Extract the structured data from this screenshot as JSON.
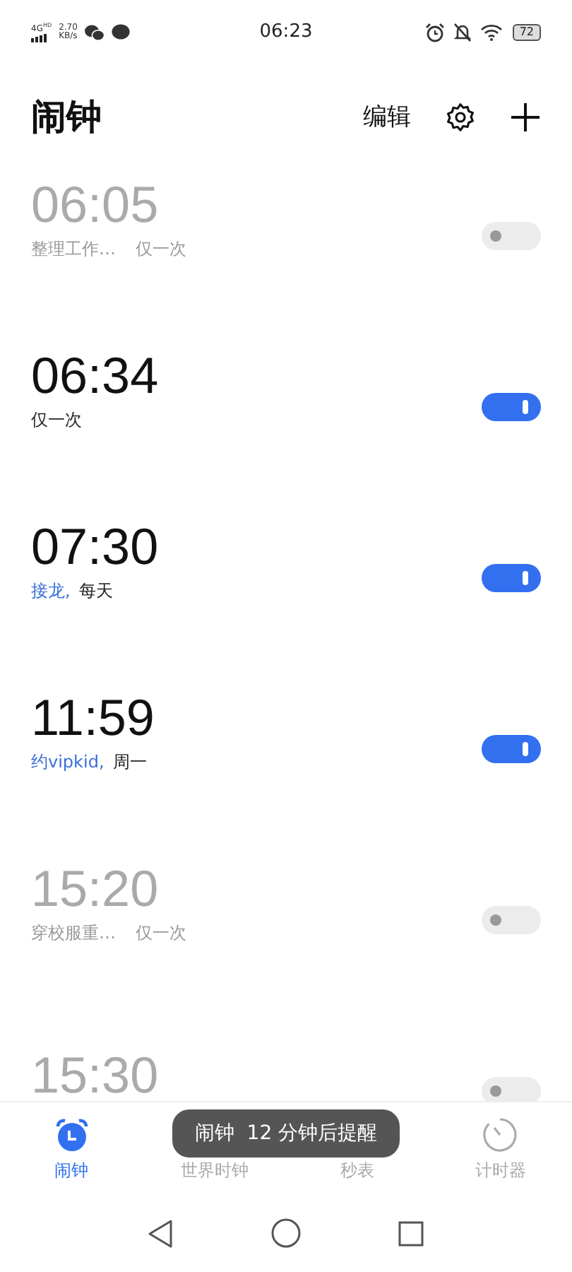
{
  "status_bar": {
    "network": "4G",
    "network_badge": "HD",
    "speed_value": "2.70",
    "speed_unit": "KB/s",
    "time": "06:23",
    "battery": "72"
  },
  "header": {
    "title": "闹钟",
    "edit": "编辑"
  },
  "alarms": [
    {
      "time": "06:05",
      "note": "整理工作…",
      "repeat": "仅一次",
      "on": false
    },
    {
      "time": "06:34",
      "repeat": "仅一次",
      "on": true
    },
    {
      "time": "07:30",
      "note": "接龙,",
      "repeat": "每天",
      "on": true
    },
    {
      "time": "11:59",
      "note": "约vipkid,",
      "repeat": "周一",
      "on": true
    },
    {
      "time": "15:20",
      "note": "穿校服重…",
      "repeat": "仅一次",
      "on": false
    },
    {
      "time": "15:30",
      "on": false
    }
  ],
  "tabs": [
    {
      "label": "闹钟",
      "kind": "alarm",
      "selected": true
    },
    {
      "label": "世界时钟",
      "selected": false
    },
    {
      "label": "秒表",
      "selected": false
    },
    {
      "label": "计时器",
      "kind": "timer",
      "selected": false
    }
  ],
  "toast": "闹钟  12 分钟后提醒"
}
